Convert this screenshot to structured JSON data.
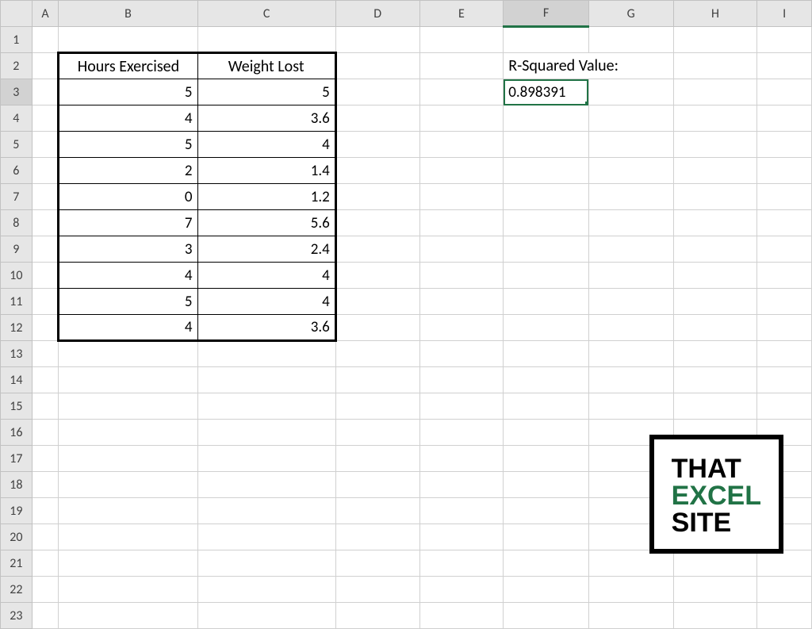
{
  "columns": [
    "A",
    "B",
    "C",
    "D",
    "E",
    "F",
    "G",
    "H",
    "I"
  ],
  "rows": [
    "1",
    "2",
    "3",
    "4",
    "5",
    "6",
    "7",
    "8",
    "9",
    "10",
    "11",
    "12",
    "13",
    "14",
    "15",
    "16",
    "17",
    "18",
    "19",
    "20",
    "21",
    "22",
    "23"
  ],
  "active_cell": "F3",
  "table": {
    "headers": {
      "B": "Hours Exercised",
      "C": "Weight Lost"
    },
    "data": [
      {
        "B": "5",
        "C": "5"
      },
      {
        "B": "4",
        "C": "3.6"
      },
      {
        "B": "5",
        "C": "4"
      },
      {
        "B": "2",
        "C": "1.4"
      },
      {
        "B": "0",
        "C": "1.2"
      },
      {
        "B": "7",
        "C": "5.6"
      },
      {
        "B": "3",
        "C": "2.4"
      },
      {
        "B": "4",
        "C": "4"
      },
      {
        "B": "5",
        "C": "4"
      },
      {
        "B": "4",
        "C": "3.6"
      }
    ]
  },
  "rsq": {
    "label": "R-Squared Value:",
    "value": "0.898391"
  },
  "logo": {
    "l1": "THAT",
    "l2": "EXCEL",
    "l3": "SITE"
  }
}
